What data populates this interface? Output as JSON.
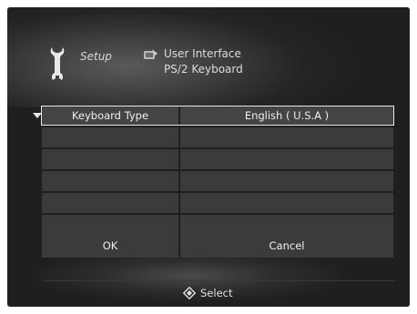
{
  "header": {
    "section_label": "Setup",
    "breadcrumb_category": "User Interface",
    "breadcrumb_page": "PS/2 Keyboard"
  },
  "settings": {
    "rows": [
      {
        "label": "Keyboard Type",
        "value": "English ( U.S.A )",
        "selected": true
      },
      {
        "label": "",
        "value": "",
        "selected": false
      },
      {
        "label": "",
        "value": "",
        "selected": false
      },
      {
        "label": "",
        "value": "",
        "selected": false
      },
      {
        "label": "",
        "value": "",
        "selected": false
      },
      {
        "label": "",
        "value": "",
        "selected": false
      }
    ]
  },
  "buttons": {
    "ok_label": "OK",
    "cancel_label": "Cancel"
  },
  "footer": {
    "hint_label": "Select"
  },
  "icons": {
    "section": "wrench-icon",
    "category": "user-interface-icon",
    "selection_marker": "triangle-down-icon",
    "hint": "select-diamond-icon"
  }
}
